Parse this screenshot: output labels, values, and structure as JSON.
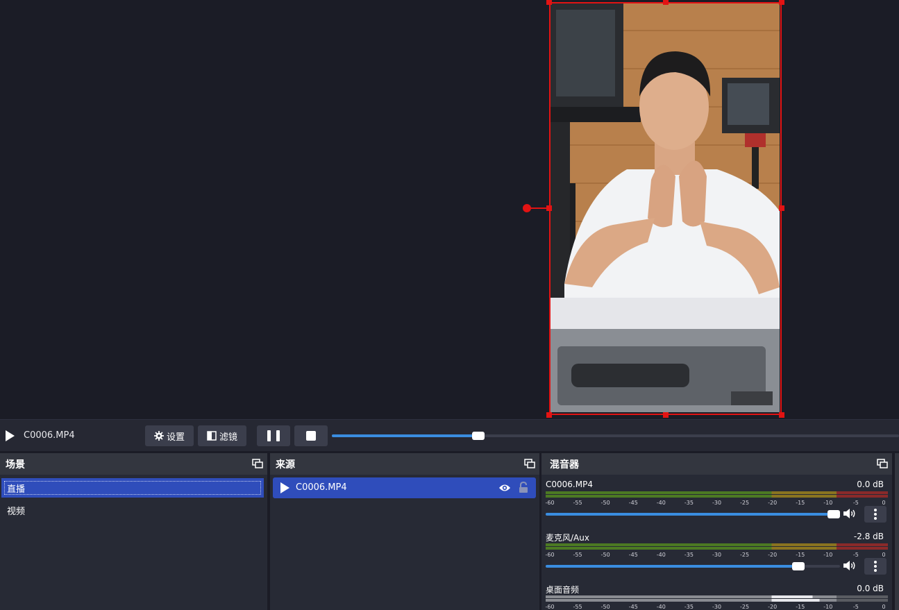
{
  "media": {
    "source_name": "C0006.MP4",
    "settings_label": "设置",
    "filters_label": "滤镜",
    "progress": 0.25
  },
  "scenes": {
    "title": "场景",
    "items": [
      "直播",
      "视频"
    ],
    "selected": 0
  },
  "sources": {
    "title": "来源",
    "items": [
      {
        "label": "C0006.MP4",
        "visible": true,
        "locked": false
      }
    ]
  },
  "mixer": {
    "title": "混音器",
    "scale": [
      "-60",
      "-55",
      "-50",
      "-45",
      "-40",
      "-35",
      "-30",
      "-25",
      "-20",
      "-15",
      "-10",
      "-5",
      "0"
    ],
    "channels": [
      {
        "name": "C0006.MP4",
        "db": "0.0 dB",
        "volume": 1.0,
        "muted": false
      },
      {
        "name": "麦克风/Aux",
        "db": "-2.8 dB",
        "volume": 0.88,
        "muted": false
      },
      {
        "name": "桌面音频",
        "db": "0.0 dB",
        "volume": 1.0,
        "muted": false
      }
    ]
  },
  "colors": {
    "accent": "#3a8de0",
    "selection": "#2f4dbb",
    "transform_red": "#e31313"
  }
}
